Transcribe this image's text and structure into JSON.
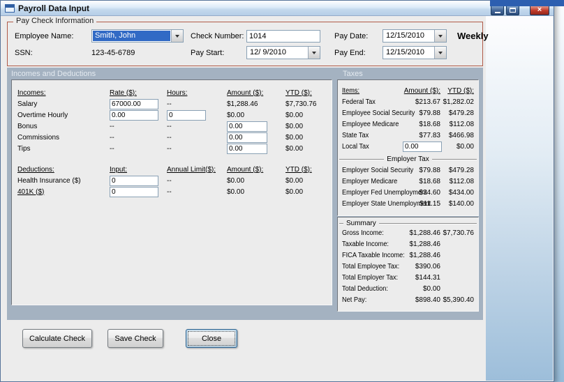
{
  "window": {
    "title": "Payroll Data Input",
    "close_glyph": "×"
  },
  "paycheck": {
    "legend": "Pay Check Information",
    "employee_name": {
      "label": "Employee Name:",
      "value": "Smith, John"
    },
    "ssn": {
      "label": "SSN:",
      "value": "123-45-6789"
    },
    "check_number": {
      "label": "Check Number:",
      "value": "1014"
    },
    "pay_start": {
      "label": "Pay Start:",
      "value": "12/ 9/2010"
    },
    "pay_date": {
      "label": "Pay Date:",
      "value": "12/15/2010"
    },
    "pay_end": {
      "label": "Pay End:",
      "value": "12/15/2010"
    },
    "frequency": "Weekly"
  },
  "sections": {
    "incomes_title": "Incomes and Deductions",
    "taxes_title": "Taxes"
  },
  "incomes": {
    "headers": [
      "Incomes:",
      "Rate ($):",
      "Hours:",
      "Amount ($):",
      "YTD ($):"
    ],
    "salary": {
      "label": "Salary",
      "rate": "67000.00",
      "hours": "--",
      "amount": "$1,288.46",
      "ytd": "$7,730.76"
    },
    "overtime": {
      "label": "Overtime Hourly",
      "rate": "0.00",
      "hours": "0",
      "amount": "$0.00",
      "ytd": "$0.00"
    },
    "bonus": {
      "label": "Bonus",
      "rate": "--",
      "hours": "--",
      "amount": "0.00",
      "ytd": "$0.00"
    },
    "commissions": {
      "label": "Commissions",
      "rate": "--",
      "hours": "--",
      "amount": "0.00",
      "ytd": "$0.00"
    },
    "tips": {
      "label": "Tips",
      "rate": "--",
      "hours": "--",
      "amount": "0.00",
      "ytd": "$0.00"
    }
  },
  "deductions": {
    "headers": [
      "Deductions:",
      "Input:",
      "Annual Limit($):",
      "Amount ($):",
      "YTD ($):"
    ],
    "health": {
      "label": "Health Insurance ($)",
      "input": "0",
      "limit": "--",
      "amount": "$0.00",
      "ytd": "$0.00"
    },
    "k401": {
      "label": "401K ($)",
      "input": "0",
      "limit": "--",
      "amount": "$0.00",
      "ytd": "$0.00"
    }
  },
  "taxes": {
    "headers": [
      "Items:",
      "Amount ($):",
      "YTD ($):"
    ],
    "rows": [
      {
        "label": "Federal Tax",
        "amount": "$213.67",
        "ytd": "$1,282.02"
      },
      {
        "label": "Employee Social Security",
        "amount": "$79.88",
        "ytd": "$479.28"
      },
      {
        "label": "Employee Medicare",
        "amount": "$18.68",
        "ytd": "$112.08"
      },
      {
        "label": "State Tax",
        "amount": "$77.83",
        "ytd": "$466.98"
      }
    ],
    "local": {
      "label": "Local Tax",
      "amount": "0.00",
      "ytd": "$0.00"
    },
    "employer_header": "Employer Tax",
    "employer_rows": [
      {
        "label": "Employer Social Security",
        "amount": "$79.88",
        "ytd": "$479.28"
      },
      {
        "label": "Employer Medicare",
        "amount": "$18.68",
        "ytd": "$112.08"
      },
      {
        "label": "Employer Fed Unemployment",
        "amount": "$34.60",
        "ytd": "$434.00"
      },
      {
        "label": "Employer State Unemployment",
        "amount": "$11.15",
        "ytd": "$140.00"
      }
    ]
  },
  "summary": {
    "title": "Summary",
    "rows": [
      {
        "label": "Gross Income:",
        "amount": "$1,288.46",
        "ytd": "$7,730.76"
      },
      {
        "label": "Taxable Income:",
        "amount": "$1,288.46",
        "ytd": ""
      },
      {
        "label": "FICA Taxable Income:",
        "amount": "$1,288.46",
        "ytd": ""
      },
      {
        "label": "Total Employee Tax:",
        "amount": "$390.06",
        "ytd": ""
      },
      {
        "label": "Total Employer Tax:",
        "amount": "$144.31",
        "ytd": ""
      },
      {
        "label": "Total Deduction:",
        "amount": "$0.00",
        "ytd": ""
      },
      {
        "label": "Net Pay:",
        "amount": "$898.40",
        "ytd": "$5,390.40"
      }
    ]
  },
  "buttons": {
    "calculate": "Calculate Check",
    "save": "Save Check",
    "close": "Close"
  },
  "colors": {
    "selection": "#316ac5",
    "section_bg": "#a4b2c1",
    "group_border": "#b05a48",
    "close_red": "#c23b2a",
    "artifact_blue": "#2d5fb0"
  }
}
